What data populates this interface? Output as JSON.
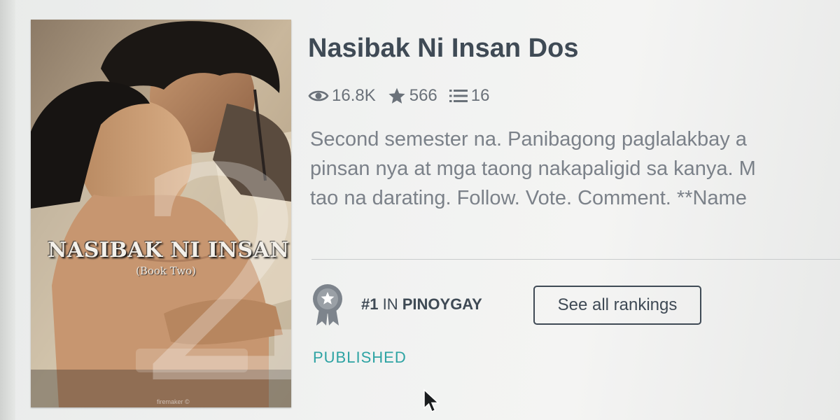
{
  "story": {
    "title": "Nasibak Ni Insan Dos",
    "stats": {
      "reads": "16.8K",
      "votes": "566",
      "parts": "16"
    },
    "description_lines": [
      "Second semester na. Panibagong paglalakbay a",
      "pinsan nya at mga taong nakapaligid sa kanya. M",
      "tao na darating. Follow. Vote. Comment. **Name"
    ],
    "ranking": {
      "rank": "#1",
      "in_label": "IN",
      "tag": "PINOYGAY"
    },
    "rankings_button_label": "See all rankings",
    "status": "PUBLISHED"
  },
  "cover": {
    "title_text": "NASIBAK NI INSAN",
    "subtitle_text": "(Book Two)",
    "numeral": "2",
    "credit": "firemaker ©"
  },
  "icons": {
    "reads": "eye-icon",
    "votes": "star-icon",
    "parts": "list-icon",
    "ranking": "ribbon-badge-icon",
    "cursor": "mouse-pointer-icon"
  },
  "colors": {
    "title": "#3f4a55",
    "meta": "#6a7179",
    "description": "#7b8189",
    "status": "#2da3a3",
    "badge": "#7d848c"
  }
}
